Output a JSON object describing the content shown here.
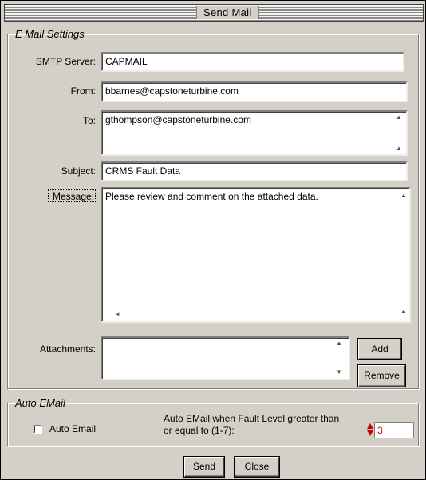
{
  "window": {
    "title": "Send Mail"
  },
  "email_settings": {
    "legend": "E Mail Settings",
    "smtp": {
      "label": "SMTP Server:",
      "value": "CAPMAIL"
    },
    "from": {
      "label": "From:",
      "value": "bbarnes@capstoneturbine.com"
    },
    "to": {
      "label": "To:",
      "value": "gthompson@capstoneturbine.com"
    },
    "subject": {
      "label": "Subject:",
      "value": "CRMS Fault Data"
    },
    "message": {
      "label": "Message:",
      "value": "Please review and comment on the attached data."
    },
    "attachments": {
      "label": "Attachments:",
      "value": ""
    },
    "add_button": "Add",
    "remove_button": "Remove"
  },
  "auto_email": {
    "legend": "Auto EMail",
    "checkbox_label": "Auto Email",
    "checked": false,
    "fault_text": "Auto EMail when Fault Level greater than\nor equal to (1-7):",
    "fault_level": "3"
  },
  "footer": {
    "send_button": "Send",
    "close_button": "Close"
  },
  "colors": {
    "window_bg": "#d4d0c8",
    "spinner_red": "#cc0000"
  }
}
